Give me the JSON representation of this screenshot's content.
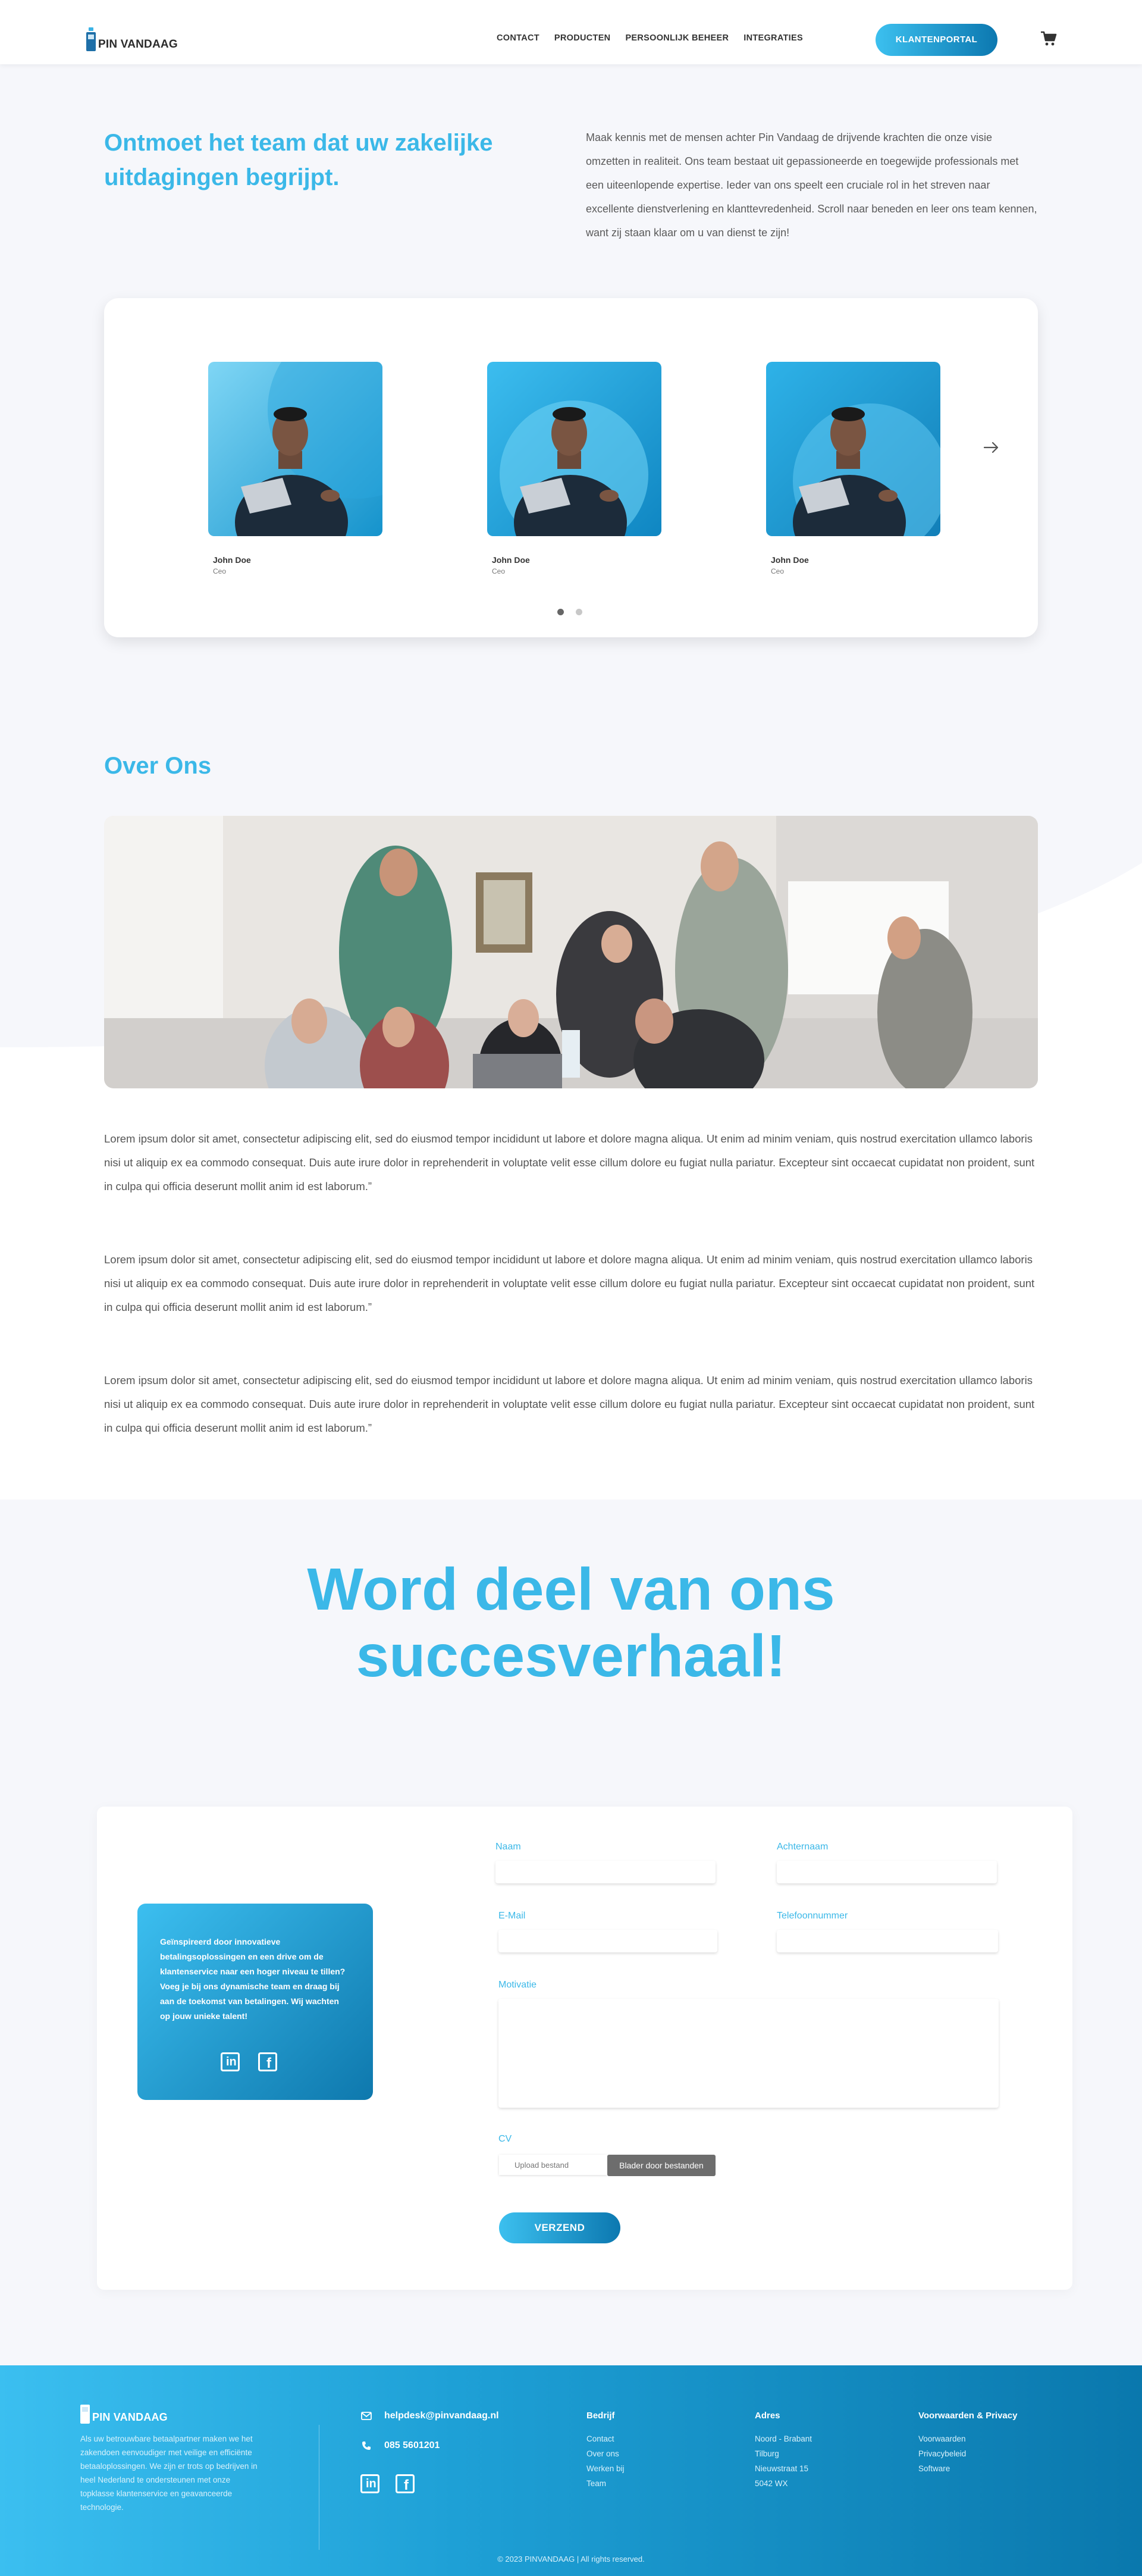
{
  "header": {
    "logo_text": "PIN VANDAAG",
    "nav": [
      "CONTACT",
      "PRODUCTEN",
      "PERSOONLIJK BEHEER",
      "INTEGRATIES"
    ],
    "portal_button": "KLANTENPORTAL",
    "cart_icon": "cart-icon"
  },
  "team": {
    "heading": "Ontmoet het team dat uw zakelijke uitdagingen begrijpt.",
    "intro": "Maak kennis met de mensen achter Pin Vandaag de drijvende krachten die onze visie omzetten in realiteit. Ons team bestaat uit gepassioneerde en toegewijde professionals met een uiteenlopende expertise. Ieder van ons speelt een cruciale rol in het streven naar excellente dienstverlening en klanttevredenheid. Scroll naar beneden en leer ons team kennen, want zij staan klaar om u van dienst te zijn!",
    "members": [
      {
        "name": "John Doe",
        "role": "Ceo"
      },
      {
        "name": "John Doe",
        "role": "Ceo"
      },
      {
        "name": "John Doe",
        "role": "Ceo"
      }
    ]
  },
  "about": {
    "title": "Over Ons",
    "paragraphs": [
      "Lorem ipsum dolor sit amet, consectetur adipiscing elit, sed do eiusmod tempor incididunt ut labore et dolore magna aliqua. Ut enim ad minim veniam, quis nostrud exercitation ullamco laboris nisi ut aliquip ex ea commodo consequat. Duis aute irure dolor in reprehenderit in voluptate velit esse cillum dolore eu fugiat nulla pariatur. Excepteur sint occaecat cupidatat non proident, sunt in culpa qui officia deserunt mollit anim id est laborum.”",
      "Lorem ipsum dolor sit amet, consectetur adipiscing elit, sed do eiusmod tempor incididunt ut labore et dolore magna aliqua. Ut enim ad minim veniam, quis nostrud exercitation ullamco laboris nisi ut aliquip ex ea commodo consequat. Duis aute irure dolor in reprehenderit in voluptate velit esse cillum dolore eu fugiat nulla pariatur. Excepteur sint occaecat cupidatat non proident, sunt in culpa qui officia deserunt mollit anim id est laborum.”",
      "Lorem ipsum dolor sit amet, consectetur adipiscing elit, sed do eiusmod tempor incididunt ut labore et dolore magna aliqua. Ut enim ad minim veniam, quis nostrud exercitation ullamco laboris nisi ut aliquip ex ea commodo consequat. Duis aute irure dolor in reprehenderit in voluptate velit esse cillum dolore eu fugiat nulla pariatur. Excepteur sint occaecat cupidatat non proident, sunt in culpa qui officia deserunt mollit anim id est laborum.”"
    ]
  },
  "join": {
    "heading_line1": "Word deel van ons",
    "heading_line2": "succesverhaal!",
    "info_text": "Geïnspireerd door innovatieve betalingsoplossingen en een drive om de klantenservice naar een hoger niveau te tillen? Voeg je bij ons dynamische team en draag bij aan de toekomst van betalingen. Wij wachten op jouw unieke talent!",
    "form": {
      "first_name_label": "Naam",
      "last_name_label": "Achternaam",
      "email_label": "E-Mail",
      "phone_label": "Telefoonnummer",
      "motivation_label": "Motivatie",
      "cv_label": "CV",
      "upload_placeholder": "Upload bestand",
      "browse_button": "Blader door bestanden",
      "submit_button": "VERZEND"
    }
  },
  "footer": {
    "logo_text": "PIN VANDAAG",
    "about": "Als uw betrouwbare betaalpartner maken we het zakendoen eenvoudiger met veilige en efficiënte betaaloplossingen. We zijn er trots op bedrijven in heel Nederland te ondersteunen met onze topklasse klantenservice en geavanceerde technologie.",
    "email": "helpdesk@pinvandaag.nl",
    "phone": "085 5601201",
    "columns": {
      "bedrijf": {
        "title": "Bedrijf",
        "items": [
          "Contact",
          "Over ons",
          "Werken bij",
          "Team"
        ]
      },
      "adres": {
        "title": "Adres",
        "items": [
          "Noord - Brabant",
          "Tilburg",
          "Nieuwstraat 15",
          "5042 WX"
        ]
      },
      "privacy": {
        "title": "Voorwaarden & Privacy",
        "items": [
          "Voorwaarden",
          "Privacybeleid",
          "Software"
        ]
      }
    },
    "copyright": "© 2023 PINVANDAAG | All rights reserved."
  },
  "colors": {
    "accent": "#3bb8e8",
    "accent_dark": "#0c78b0",
    "background": "#f6f7fb"
  }
}
